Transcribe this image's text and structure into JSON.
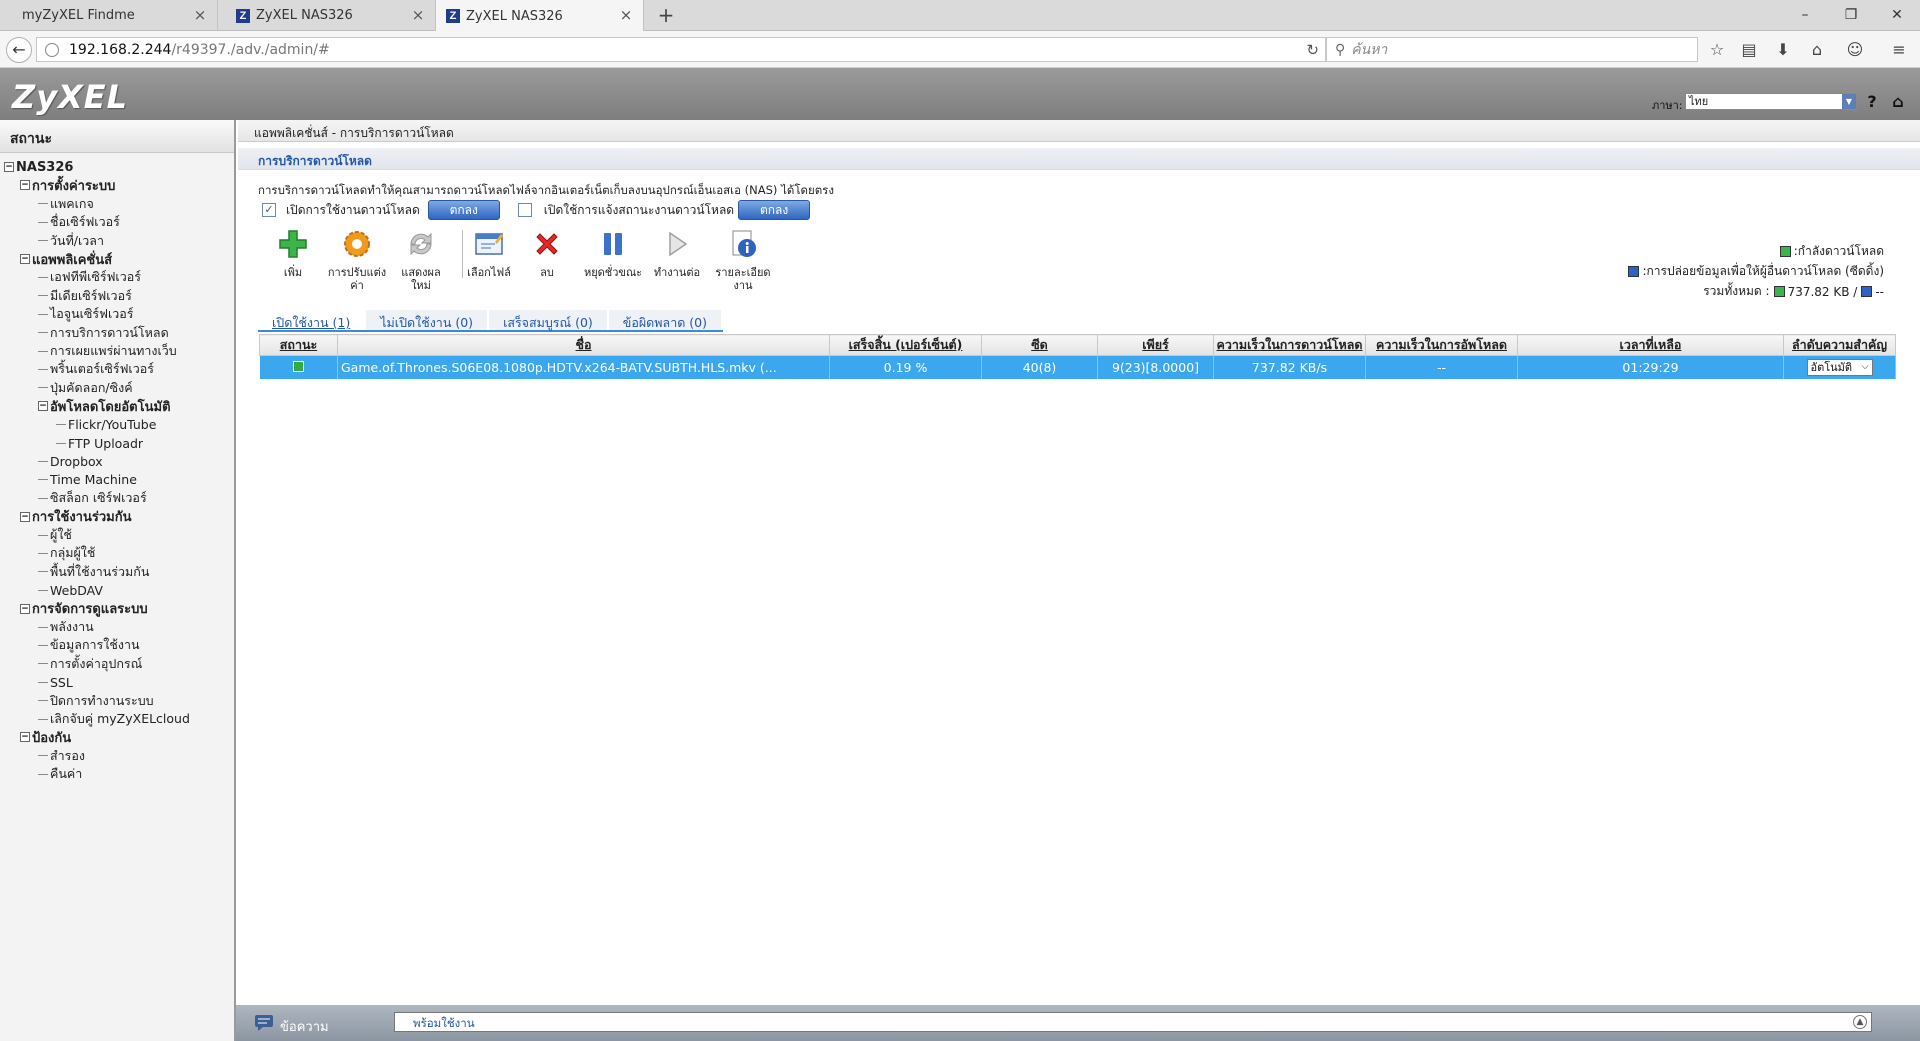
{
  "browser": {
    "tabs": [
      {
        "title": "myZyXEL Findme",
        "active": false,
        "icon": "none"
      },
      {
        "title": "ZyXEL NAS326",
        "active": false,
        "icon": "zyxel-z-icon"
      },
      {
        "title": "ZyXEL NAS326",
        "active": true,
        "icon": "zyxel-z-icon"
      }
    ],
    "url_host": "192.168.2.244",
    "url_path": "/r49397./adv./admin/#",
    "search_placeholder": "ค้นหา"
  },
  "header": {
    "logo": "ZyXEL",
    "language_label": "ภาษา:",
    "language_value": "ไทย"
  },
  "sidebar": {
    "title": "สถานะ",
    "root": "NAS326",
    "groups": [
      {
        "label": "การตั้งค่าระบบ",
        "items": [
          "แพคเกจ",
          "ชื่อเซิร์ฟเวอร์",
          "วันที่/เวลา"
        ]
      },
      {
        "label": "แอพพลิเคชั่นส์",
        "items": [
          "เอฟทีพีเซิร์ฟเวอร์",
          "มีเดียเซิร์ฟเวอร์",
          "ไอจูนเซิร์ฟเวอร์",
          "การบริการดาวน์โหลด",
          "การเผยแพร่ผ่านทางเว็บ",
          "พริ้นเตอร์เซิร์ฟเวอร์",
          "ปุ่มคัดลอก/ซิงค์"
        ]
      },
      {
        "label": "อัพโหลดโดยอัตโนมัติ",
        "items": [
          "Flickr/YouTube",
          "FTP Uploadr"
        ]
      },
      {
        "label": "",
        "items": [
          "Dropbox",
          "Time Machine",
          "ซิสล็อก เซิร์ฟเวอร์"
        ]
      },
      {
        "label": "การใช้งานร่วมกัน",
        "items": [
          "ผู้ใช้",
          "กลุ่มผู้ใช้",
          "พื้นที่ใช้งานร่วมกัน",
          "WebDAV"
        ]
      },
      {
        "label": "การจัดการดูแลระบบ",
        "items": [
          "พลังงาน",
          "ข้อมูลการใช้งาน",
          "การตั้งค่าอุปกรณ์",
          "SSL",
          "ปิดการทำงานระบบ",
          "เลิกจับคู่ myZyXELcloud"
        ]
      },
      {
        "label": "ป้องกัน",
        "items": [
          "สำรอง",
          "คืนค่า"
        ]
      }
    ]
  },
  "content": {
    "breadcrumb": "แอพพลิเคชั่นส์ - การบริการดาวน์โหลด",
    "section_title": "การบริการดาวน์โหลด",
    "description": "การบริการดาวน์โหลดทำให้คุณสามารถดาวน์โหลดไฟล์จากอินเตอร์เน็ตเก็บลงบนอุปกรณ์เอ็นเอสเอ (NAS) ได้โดยตรง",
    "enable_download_label": "เปิดการใช้งานดาวน์โหลด",
    "enable_download_checked": true,
    "enable_notify_label": "เปิดใช้การแจ้งสถานะงานดาวน์โหลด",
    "enable_notify_checked": false,
    "ok_label": "ตกลง",
    "toolbar": [
      {
        "label1": "เพิ่ม",
        "label2": "",
        "icon": "add-icon"
      },
      {
        "label1": "การปรับแต่ง",
        "label2": "ค่า",
        "icon": "settings-icon"
      },
      {
        "label1": "แสดงผล",
        "label2": "ใหม่",
        "icon": "refresh-icon"
      },
      {
        "label1": "เลือกไฟล์",
        "label2": "",
        "icon": "select-file-icon"
      },
      {
        "label1": "ลบ",
        "label2": "",
        "icon": "delete-icon"
      },
      {
        "label1": "หยุดชั่วขณะ",
        "label2": "",
        "icon": "pause-icon"
      },
      {
        "label1": "ทำงานต่อ",
        "label2": "",
        "icon": "resume-icon"
      },
      {
        "label1": "รายละเอียด",
        "label2": "งาน",
        "icon": "info-icon"
      }
    ],
    "legend": {
      "downloading": ":กำลังดาวน์โหลด",
      "seeding": ":การปล่อยข้อมูลเพื่อให้ผู้อื่นดาวน์โหลด (ซีดดิ้ง)",
      "total_label": "รวมทั้งหมด :",
      "total_down": "737.82 KB /",
      "total_up": "--"
    },
    "tabs": [
      {
        "label": "เปิดใช้งาน (1)",
        "active": true
      },
      {
        "label": "ไม่เปิดใช้งาน (0)",
        "active": false
      },
      {
        "label": "เสร็จสมบูรณ์ (0)",
        "active": false
      },
      {
        "label": "ข้อผิดพลาด (0)",
        "active": false
      }
    ],
    "columns": [
      "สถานะ",
      "ชื่อ",
      "เสร็จสิ้น (เปอร์เซ็นต์)",
      "ซีด",
      "เพียร์",
      "ความเร็วในการดาวน์โหลด",
      "ความเร็วในการอัพโหลด",
      "เวลาที่เหลือ",
      "ลำดับความสำคัญ"
    ],
    "rows": [
      {
        "name": "Game.of.Thrones.S06E08.1080p.HDTV.x264-BATV.SUBTH.HLS.mkv (...",
        "done": "0.19 %",
        "seeds": "40(8)",
        "peers": "9(23)[8.0000]",
        "down": "737.82 KB/s",
        "up": "--",
        "remaining": "01:29:29",
        "priority": "อัตโนมัติ"
      }
    ]
  },
  "statusbar": {
    "label": "ข้อความ",
    "message": "พร้อมใช้งาน"
  },
  "colors": {
    "selected_row": "#3ba7ee",
    "accent_blue": "#2357a6",
    "header_gray": "#8a8a8a"
  }
}
